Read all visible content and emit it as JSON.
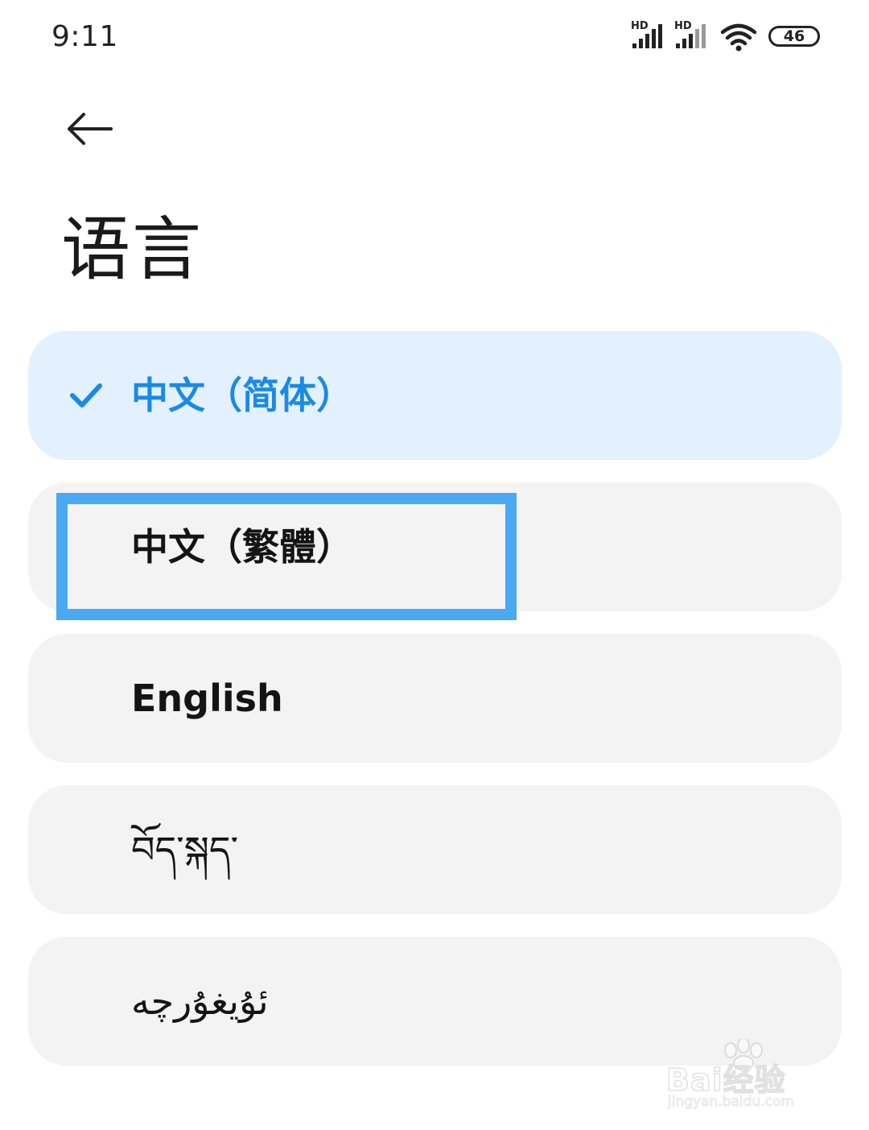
{
  "status_bar": {
    "time": "9:11",
    "signal_1_label": "HD",
    "signal_2_label": "HD",
    "battery": "46"
  },
  "header": {
    "back_icon": "back-arrow-icon",
    "title": "语言"
  },
  "languages": [
    {
      "label": "中文（简体）",
      "selected": true
    },
    {
      "label": "中文（繁體）",
      "selected": false
    },
    {
      "label": "English",
      "selected": false
    },
    {
      "label": "བོད་སྐད་",
      "selected": false
    },
    {
      "label": "ئۇيغۇرچە",
      "selected": false
    }
  ],
  "watermark": {
    "brand": "Bai经验",
    "url": "jingyan.baidu.com"
  },
  "colors": {
    "accent": "#1a8ae5",
    "selected_bg": "#e3f0fd",
    "item_bg": "#f3f3f3",
    "highlight_box": "#4aa9f3"
  }
}
